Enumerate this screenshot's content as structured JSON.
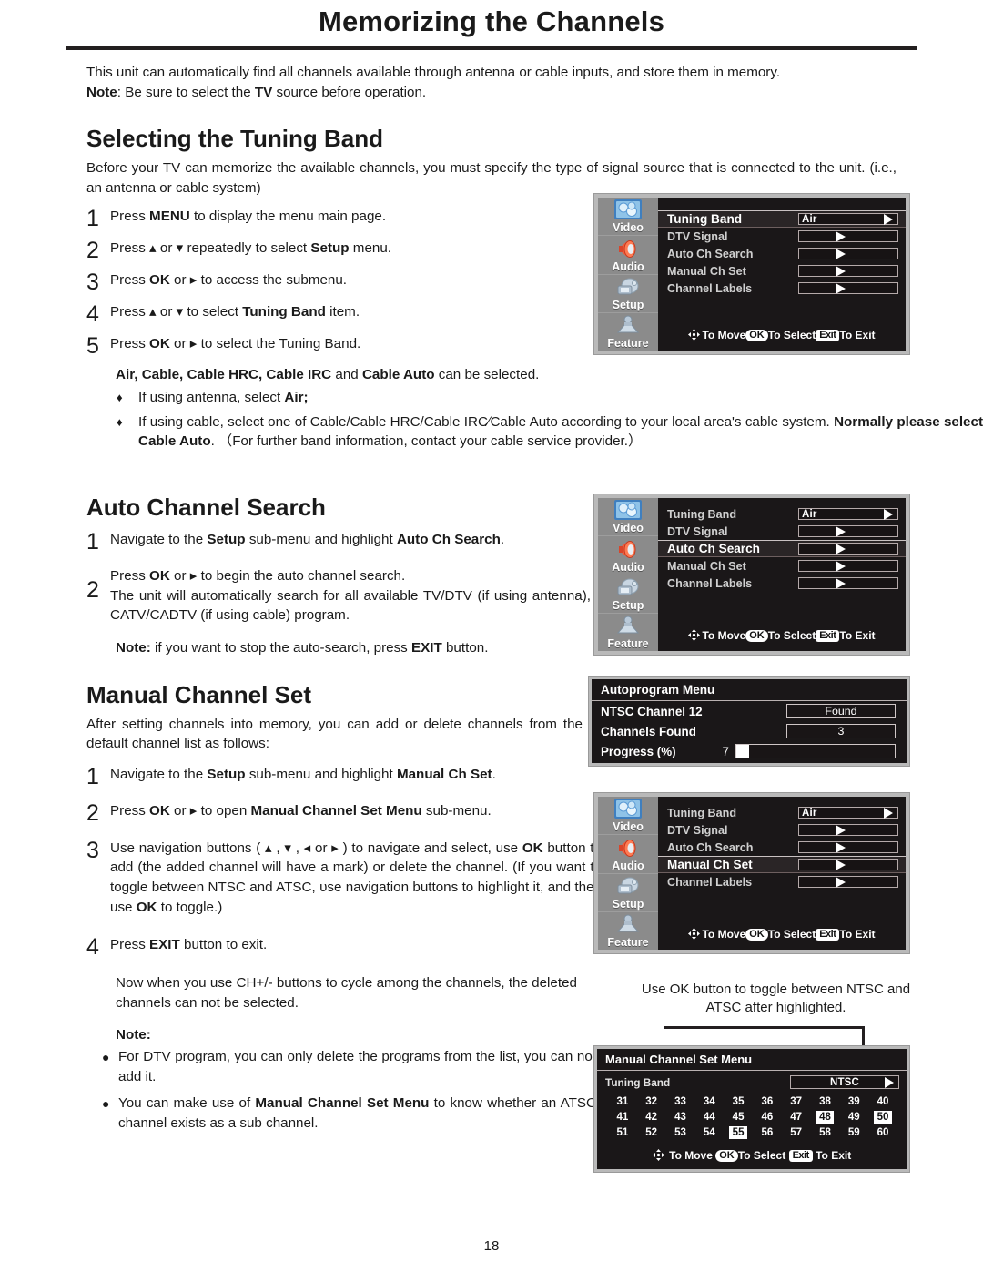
{
  "document": {
    "title": "Memorizing the Channels",
    "page_number": "18",
    "intro_line1": "This unit can automatically find all channels available through antenna or cable inputs, and store them in memory.",
    "note_label": "Note",
    "note_text": ": Be sure to select the ",
    "note_bold": "TV",
    "note_tail": " source before operation."
  },
  "sections": {
    "tuning_band": {
      "heading": "Selecting the Tuning Band",
      "intro": "Before your TV can memorize the available channels, you must specify the type of signal source that is connected to the unit. (i.e., an antenna or cable system)",
      "steps": [
        {
          "num": "1",
          "parts": [
            "Press  ",
            "MENU",
            " to display the menu main page."
          ]
        },
        {
          "num": "2",
          "parts": [
            "Press ▴ or ▾ repeatedly to select ",
            "Setup",
            " menu."
          ]
        },
        {
          "num": "3",
          "parts": [
            "Press ",
            "OK",
            " or ▸ to access the submenu."
          ]
        },
        {
          "num": "4",
          "parts": [
            "Press ▴ or ▾ to select ",
            "Tuning Band",
            " item."
          ]
        },
        {
          "num": "5",
          "parts": [
            "Press ",
            "OK",
            "  or ▸ to select the Tuning Band."
          ]
        }
      ],
      "options_line_bold": "Air, Cable, Cable HRC, Cable IRC",
      "options_line_mid": " and ",
      "options_line_bold2": "Cable Auto",
      "options_line_tail": " can be selected.",
      "bullets": [
        {
          "mark": "♦",
          "pre": "If using antenna, select ",
          "bold": "Air;",
          "post": ""
        },
        {
          "mark": "♦",
          "pre": "If using cable, select one of Cable/Cable HRC/Cable IRC∕Cable  Auto according to your local area's cable system.  ",
          "bold": "Normally please select Cable Auto",
          "post": ". （For further band information,  contact your cable service provider.）"
        }
      ]
    },
    "auto_channel_search": {
      "heading": "Auto Channel Search",
      "steps": [
        {
          "num": "1",
          "parts": [
            "Navigate to the ",
            "Setup",
            " sub-menu and highlight ",
            "Auto Ch Search",
            "."
          ]
        },
        {
          "num": "2",
          "parts": [
            "Press ",
            "OK",
            "  or ▸ to begin the auto channel search.",
            "The unit will automatically search for all available TV/DTV (if using antenna), CATV/CADTV (if using cable) program."
          ]
        }
      ],
      "note_label": "Note:",
      "note_text": " if you want to stop the auto-search, press ",
      "note_bold": "EXIT",
      "note_tail": " button."
    },
    "manual_channel_set": {
      "heading": "Manual Channel Set",
      "intro": "After setting channels into memory, you can add or delete channels from the default channel list as follows:",
      "steps": [
        {
          "num": "1",
          "parts": [
            "Navigate to the ",
            "Setup",
            " sub-menu and highlight ",
            "Manual Ch Set",
            "."
          ]
        },
        {
          "num": "2",
          "parts": [
            "Press ",
            "OK",
            "  or ▸ to open ",
            "Manual Channel Set Menu",
            " sub-menu."
          ]
        },
        {
          "num": "3",
          "parts": [
            "Use navigation buttons ( ▴ , ▾ , ◂ or ▸ ) to navigate and select, use ",
            "OK",
            " button to add (the added channel will have a mark) or delete the channel.  (If you want to toggle between NTSC and ATSC, ᴜse navigation buttons to highlight it, and then use ",
            "OK",
            " to toggle.)"
          ]
        },
        {
          "num": "4",
          "parts": [
            "Press ",
            "EXIT",
            " button to exit."
          ]
        }
      ],
      "after_text": "Now when you use CH+/- buttons to cycle among the channels, the deleted channels can not be selected.",
      "note_label": "Note:",
      "notes": [
        {
          "mark": "●",
          "pre": "For DTV program, you can only delete the programs from the list, you can not add it.",
          "bold": "",
          "post": ""
        },
        {
          "mark": "●",
          "pre": "You can make use of ",
          "bold": "Manual Channel Set Menu",
          "post": " to know whether an ATSC channel exists as a sub channel."
        }
      ]
    }
  },
  "osd": {
    "sidebar": [
      {
        "label": "Video",
        "icon": "video-icon"
      },
      {
        "label": "Audio",
        "icon": "speaker-icon"
      },
      {
        "label": "Setup",
        "icon": "setup-icon"
      },
      {
        "label": "Feature",
        "icon": "feature-icon"
      }
    ],
    "footer": {
      "move": "To Move",
      "ok_key": "OK",
      "select": "To Select",
      "exit_key": "Exit",
      "exit": "To Exit",
      "nav_glyph": "nav-pad-icon"
    },
    "menu_items": [
      {
        "label": "Tuning Band",
        "value": "Air"
      },
      {
        "label": "DTV Signal",
        "value": ""
      },
      {
        "label": "Auto Ch Search",
        "value": ""
      },
      {
        "label": "Manual Ch Set",
        "value": ""
      },
      {
        "label": "Channel Labels",
        "value": ""
      }
    ],
    "panel1_selected": "Tuning Band",
    "panel2_selected": "Auto Ch Search",
    "panel3_selected": "Manual Ch Set"
  },
  "autoprogram": {
    "title": "Autoprogram Menu",
    "rows": [
      {
        "label": "NTSC Channel 12",
        "value": "Found"
      },
      {
        "label": "Channels Found",
        "value": "3"
      }
    ],
    "progress_label": "Progress (%)",
    "progress_value": "7",
    "progress_percent": 7
  },
  "manual_channel_menu": {
    "title": "Manual Channel Set Menu",
    "band_label": "Tuning Band",
    "band_value": "NTSC",
    "channels": [
      [
        "31",
        "32",
        "33",
        "34",
        "35",
        "36",
        "37",
        "38",
        "39",
        "40"
      ],
      [
        "41",
        "42",
        "43",
        "44",
        "45",
        "46",
        "47",
        "48",
        "49",
        "50"
      ],
      [
        "51",
        "52",
        "53",
        "54",
        "55",
        "56",
        "57",
        "58",
        "59",
        "60"
      ]
    ],
    "marked": [
      "48",
      "50",
      "55"
    ],
    "callout": "Use OK button to toggle between NTSC and ATSC after highlighted."
  }
}
